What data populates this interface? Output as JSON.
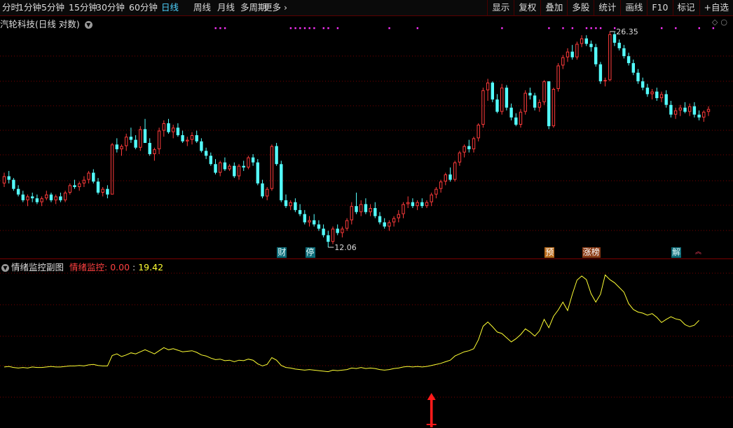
{
  "toolbar": {
    "periods": [
      "分时",
      "1分钟",
      "5分钟",
      "15分钟",
      "30分钟",
      "60分钟",
      "日线",
      "周线",
      "月线",
      "多周期",
      "更多"
    ],
    "active_period": "日线",
    "buttons": [
      "显示",
      "复权",
      "叠加",
      "多股",
      "统计",
      "画线",
      "F10",
      "标记",
      "+自选"
    ]
  },
  "chart": {
    "stock_name": "汽轮科技",
    "period_label": "(日线 对数)",
    "high_label": "26.35",
    "low_label": "12.06"
  },
  "markers": [
    {
      "text": "财",
      "style": "cyan"
    },
    {
      "text": "停",
      "style": "cyan"
    },
    {
      "text": "预",
      "style": "orange"
    },
    {
      "text": "涨榜",
      "style": "orange"
    },
    {
      "text": "解",
      "style": "cyan"
    }
  ],
  "subchart": {
    "title": "情绪监控副图",
    "indicator_name": "情绪监控:",
    "value1": "0.00",
    "value2": "19.42"
  },
  "colors": {
    "up": "#ff3b3b",
    "down": "#54ffff",
    "indicator": "#ffff33",
    "grid": "#7a0000",
    "dot": "#ff33ff"
  },
  "chart_data": {
    "type": "candlestick",
    "candles": [
      [
        15.2,
        15.8,
        15.0,
        15.6
      ],
      [
        15.6,
        15.9,
        15.2,
        15.4
      ],
      [
        15.4,
        15.5,
        14.8,
        14.9
      ],
      [
        14.9,
        15.1,
        14.5,
        14.6
      ],
      [
        14.6,
        14.8,
        14.2,
        14.3
      ],
      [
        14.3,
        14.6,
        14.0,
        14.5
      ],
      [
        14.5,
        14.7,
        14.2,
        14.4
      ],
      [
        14.4,
        14.6,
        14.1,
        14.2
      ],
      [
        14.2,
        14.5,
        14.0,
        14.4
      ],
      [
        14.4,
        14.8,
        14.3,
        14.6
      ],
      [
        14.6,
        14.7,
        14.2,
        14.3
      ],
      [
        14.3,
        14.6,
        14.1,
        14.5
      ],
      [
        14.5,
        14.7,
        14.2,
        14.3
      ],
      [
        14.3,
        14.8,
        14.2,
        14.7
      ],
      [
        14.7,
        15.2,
        14.6,
        15.1
      ],
      [
        15.1,
        15.4,
        14.9,
        15.0
      ],
      [
        15.0,
        15.3,
        14.8,
        15.2
      ],
      [
        15.2,
        15.6,
        15.0,
        15.4
      ],
      [
        15.4,
        15.9,
        15.2,
        15.8
      ],
      [
        15.8,
        16.0,
        15.2,
        15.3
      ],
      [
        15.3,
        15.5,
        14.6,
        14.7
      ],
      [
        14.7,
        15.0,
        14.5,
        14.9
      ],
      [
        14.9,
        15.1,
        14.4,
        14.6
      ],
      [
        14.6,
        17.6,
        14.6,
        17.5
      ],
      [
        17.5,
        17.9,
        17.0,
        17.2
      ],
      [
        17.2,
        17.5,
        16.8,
        17.4
      ],
      [
        17.4,
        18.2,
        17.1,
        18.0
      ],
      [
        18.0,
        18.6,
        17.6,
        17.8
      ],
      [
        17.8,
        18.1,
        17.2,
        17.3
      ],
      [
        17.3,
        18.7,
        17.1,
        18.5
      ],
      [
        18.5,
        19.2,
        17.8,
        17.6
      ],
      [
        17.6,
        17.9,
        16.8,
        16.9
      ],
      [
        16.9,
        17.3,
        16.5,
        17.2
      ],
      [
        17.2,
        18.6,
        16.9,
        18.4
      ],
      [
        18.4,
        19.1,
        18.0,
        18.9
      ],
      [
        18.9,
        19.2,
        18.2,
        18.3
      ],
      [
        18.3,
        18.8,
        17.9,
        18.6
      ],
      [
        18.6,
        18.9,
        18.0,
        18.1
      ],
      [
        18.1,
        18.4,
        17.6,
        17.7
      ],
      [
        17.7,
        18.0,
        17.4,
        17.8
      ],
      [
        17.8,
        18.3,
        17.5,
        18.1
      ],
      [
        18.1,
        18.4,
        17.6,
        17.7
      ],
      [
        17.7,
        17.9,
        17.0,
        17.1
      ],
      [
        17.1,
        17.3,
        16.6,
        16.8
      ],
      [
        16.8,
        17.0,
        16.2,
        16.3
      ],
      [
        16.3,
        16.6,
        15.7,
        15.8
      ],
      [
        15.8,
        16.5,
        15.6,
        16.4
      ],
      [
        16.4,
        16.7,
        15.9,
        16.0
      ],
      [
        16.0,
        16.3,
        15.9,
        16.2
      ],
      [
        16.2,
        16.4,
        15.5,
        15.6
      ],
      [
        15.6,
        16.3,
        15.4,
        16.2
      ],
      [
        16.2,
        16.5,
        15.9,
        16.1
      ],
      [
        16.1,
        16.8,
        16.0,
        16.7
      ],
      [
        16.7,
        16.9,
        16.2,
        16.4
      ],
      [
        16.4,
        16.6,
        15.1,
        15.2
      ],
      [
        15.2,
        15.4,
        14.4,
        14.5
      ],
      [
        14.5,
        15.0,
        14.3,
        14.9
      ],
      [
        14.9,
        17.5,
        14.8,
        17.4
      ],
      [
        17.4,
        17.6,
        16.2,
        16.3
      ],
      [
        16.3,
        16.5,
        14.2,
        14.3
      ],
      [
        14.3,
        14.6,
        13.9,
        14.0
      ],
      [
        14.0,
        14.3,
        13.8,
        14.2
      ],
      [
        14.2,
        14.4,
        13.7,
        13.8
      ],
      [
        13.8,
        14.1,
        13.5,
        13.6
      ],
      [
        13.6,
        13.8,
        13.1,
        13.2
      ],
      [
        13.2,
        13.5,
        13.0,
        13.3
      ],
      [
        13.3,
        13.6,
        13.0,
        13.1
      ],
      [
        13.1,
        13.3,
        12.8,
        12.9
      ],
      [
        12.9,
        13.1,
        12.5,
        12.6
      ],
      [
        12.6,
        12.8,
        12.06,
        12.3
      ],
      [
        12.3,
        13.0,
        12.2,
        12.9
      ],
      [
        12.9,
        13.1,
        12.6,
        12.7
      ],
      [
        12.7,
        13.0,
        12.5,
        12.9
      ],
      [
        12.9,
        13.4,
        12.8,
        13.3
      ],
      [
        13.3,
        14.2,
        13.1,
        14.0
      ],
      [
        14.0,
        14.7,
        13.6,
        13.7
      ],
      [
        13.7,
        14.3,
        13.5,
        14.1
      ],
      [
        14.1,
        14.4,
        13.6,
        13.7
      ],
      [
        13.7,
        14.1,
        13.5,
        13.9
      ],
      [
        13.9,
        14.2,
        13.4,
        13.5
      ],
      [
        13.5,
        13.7,
        13.1,
        13.2
      ],
      [
        13.2,
        13.4,
        12.9,
        13.0
      ],
      [
        13.0,
        13.3,
        12.8,
        13.2
      ],
      [
        13.2,
        13.5,
        13.0,
        13.4
      ],
      [
        13.4,
        13.8,
        13.2,
        13.6
      ],
      [
        13.6,
        14.2,
        13.4,
        14.1
      ],
      [
        14.1,
        14.5,
        13.9,
        14.2
      ],
      [
        14.2,
        14.4,
        13.9,
        14.0
      ],
      [
        14.0,
        14.3,
        13.8,
        14.2
      ],
      [
        14.2,
        14.4,
        13.9,
        14.0
      ],
      [
        14.0,
        14.3,
        13.9,
        14.2
      ],
      [
        14.2,
        14.7,
        14.0,
        14.6
      ],
      [
        14.6,
        15.0,
        14.4,
        14.9
      ],
      [
        14.9,
        15.4,
        14.7,
        15.3
      ],
      [
        15.3,
        15.8,
        15.1,
        15.7
      ],
      [
        15.7,
        16.1,
        15.3,
        15.4
      ],
      [
        15.4,
        16.5,
        15.3,
        16.4
      ],
      [
        16.4,
        17.1,
        16.2,
        17.0
      ],
      [
        17.0,
        17.5,
        16.7,
        17.4
      ],
      [
        17.4,
        17.8,
        17.0,
        17.2
      ],
      [
        17.2,
        18.0,
        17.0,
        17.9
      ],
      [
        17.9,
        18.9,
        17.7,
        18.8
      ],
      [
        18.8,
        21.5,
        18.6,
        21.3
      ],
      [
        21.3,
        22.2,
        20.5,
        21.9
      ],
      [
        21.9,
        22.0,
        20.4,
        20.6
      ],
      [
        20.6,
        21.0,
        19.6,
        19.7
      ],
      [
        19.7,
        21.8,
        19.5,
        21.5
      ],
      [
        21.5,
        21.7,
        19.8,
        20.0
      ],
      [
        20.0,
        20.3,
        19.1,
        19.3
      ],
      [
        19.3,
        19.6,
        18.7,
        18.8
      ],
      [
        18.8,
        19.9,
        18.6,
        19.7
      ],
      [
        19.7,
        21.3,
        19.5,
        21.1
      ],
      [
        21.1,
        21.5,
        20.6,
        20.9
      ],
      [
        20.9,
        21.1,
        19.8,
        20.0
      ],
      [
        20.0,
        20.6,
        19.7,
        20.4
      ],
      [
        20.4,
        22.1,
        20.2,
        22.0
      ],
      [
        22.0,
        20.3,
        18.5,
        18.7
      ],
      [
        18.7,
        21.5,
        18.6,
        21.4
      ],
      [
        21.4,
        23.5,
        21.2,
        23.3
      ],
      [
        23.3,
        24.2,
        23.0,
        24.0
      ],
      [
        24.0,
        24.8,
        23.6,
        24.5
      ],
      [
        24.5,
        25.1,
        23.8,
        24.0
      ],
      [
        24.0,
        25.4,
        23.8,
        25.2
      ],
      [
        25.2,
        26.0,
        24.9,
        25.7
      ],
      [
        25.7,
        26.0,
        25.0,
        25.2
      ],
      [
        25.2,
        25.5,
        24.5,
        24.9
      ],
      [
        24.9,
        25.2,
        23.2,
        23.4
      ],
      [
        23.4,
        23.6,
        21.8,
        22.0
      ],
      [
        22.0,
        22.3,
        21.6,
        22.1
      ],
      [
        22.1,
        26.35,
        22.0,
        26.1
      ],
      [
        26.1,
        26.3,
        25.0,
        25.3
      ],
      [
        25.3,
        25.6,
        24.6,
        24.8
      ],
      [
        24.8,
        25.1,
        23.9,
        24.1
      ],
      [
        24.1,
        24.4,
        23.3,
        23.5
      ],
      [
        23.5,
        23.8,
        22.5,
        22.7
      ],
      [
        22.7,
        23.0,
        21.8,
        22.0
      ],
      [
        22.0,
        22.3,
        21.3,
        21.5
      ],
      [
        21.5,
        21.8,
        20.8,
        21.0
      ],
      [
        21.0,
        21.4,
        20.6,
        21.2
      ],
      [
        21.2,
        21.5,
        20.5,
        20.7
      ],
      [
        20.7,
        21.2,
        20.4,
        21.0
      ],
      [
        21.0,
        21.3,
        20.0,
        20.2
      ],
      [
        20.2,
        20.5,
        19.3,
        19.5
      ],
      [
        19.5,
        20.0,
        19.2,
        19.8
      ],
      [
        19.8,
        20.2,
        19.4,
        20.0
      ],
      [
        20.0,
        20.4,
        19.6,
        19.7
      ],
      [
        19.7,
        20.3,
        19.4,
        20.1
      ],
      [
        20.1,
        20.4,
        19.3,
        19.5
      ],
      [
        19.5,
        19.8,
        19.1,
        19.3
      ],
      [
        19.3,
        19.8,
        19.0,
        19.7
      ],
      [
        19.7,
        20.1,
        19.4,
        19.9
      ]
    ],
    "indicator": [
      4.3,
      4.4,
      4.2,
      4.1,
      4.2,
      4.1,
      4.3,
      4.2,
      4.2,
      4.3,
      4.4,
      4.3,
      4.3,
      4.4,
      4.5,
      4.5,
      4.6,
      4.5,
      4.7,
      4.8,
      4.6,
      4.5,
      4.5,
      6.5,
      6.8,
      6.3,
      6.6,
      7.0,
      6.8,
      7.2,
      7.6,
      7.2,
      6.8,
      7.4,
      8.0,
      7.6,
      7.8,
      7.5,
      7.2,
      7.3,
      7.4,
      7.1,
      6.6,
      6.4,
      6.0,
      5.7,
      5.8,
      5.5,
      5.6,
      5.3,
      5.6,
      5.5,
      5.8,
      5.6,
      4.9,
      4.5,
      4.8,
      6.1,
      5.6,
      4.6,
      4.2,
      4.1,
      3.9,
      3.8,
      3.7,
      3.8,
      3.7,
      3.6,
      3.5,
      3.4,
      3.7,
      3.6,
      3.7,
      3.8,
      4.1,
      4.0,
      4.2,
      4.0,
      4.1,
      4.0,
      3.8,
      3.7,
      3.8,
      4.0,
      4.1,
      4.3,
      4.4,
      4.3,
      4.4,
      4.3,
      4.4,
      4.6,
      4.8,
      5.0,
      5.3,
      5.6,
      6.4,
      6.8,
      7.2,
      7.4,
      7.8,
      9.5,
      12.1,
      12.9,
      12.0,
      11.0,
      10.7,
      9.9,
      9.1,
      9.7,
      10.5,
      11.6,
      11.0,
      10.2,
      11.2,
      13.4,
      11.8,
      14.0,
      15.2,
      16.7,
      15.1,
      18.2,
      20.9,
      21.7,
      21.0,
      18.3,
      16.7,
      18.2,
      21.9,
      21.0,
      20.4,
      19.5,
      18.6,
      16.4,
      15.3,
      14.8,
      14.6,
      14.2,
      14.5,
      13.8,
      12.8,
      13.4,
      13.9,
      13.5,
      13.3,
      12.4,
      12.0,
      12.3,
      13.2
    ]
  }
}
